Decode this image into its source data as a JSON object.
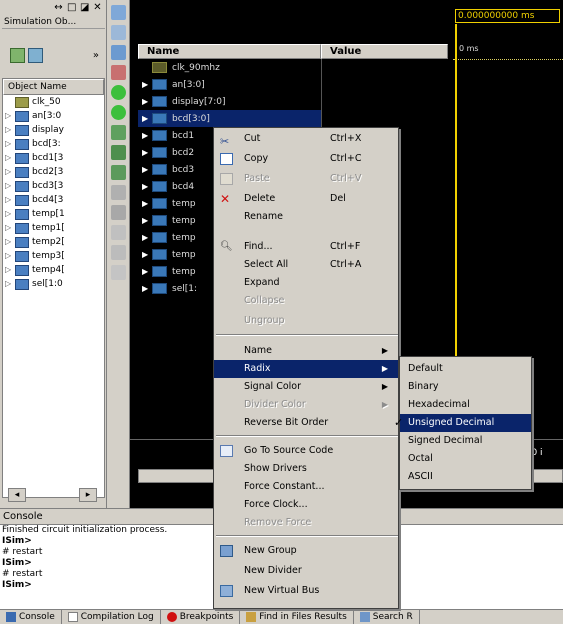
{
  "left_panel": {
    "title_icons": [
      "pin-icon",
      "restore-icon",
      "maximize-icon",
      "close-icon"
    ],
    "title": "Simulation Ob...",
    "toolbar_more": "»",
    "column_header": "Object Name",
    "objects": [
      "clk_50",
      "an[3:0",
      "display",
      "bcd[3:",
      "bcd1[3",
      "bcd2[3",
      "bcd3[3",
      "bcd4[3",
      "temp[1",
      "temp1[",
      "temp2[",
      "temp3[",
      "temp4[",
      "sel[1:0"
    ]
  },
  "wave": {
    "name_header": "Name",
    "value_header": "Value",
    "time_value": "0.000000000 ms",
    "ruler_label": "0 ms",
    "right_time": "000 i",
    "signals": [
      "clk_90mhz",
      "an[3:0]",
      "display[7:0]",
      "bcd[3:0]",
      "bcd1",
      "bcd2",
      "bcd3",
      "bcd4",
      "temp",
      "temp",
      "temp",
      "temp",
      "temp",
      "sel[1:"
    ]
  },
  "context_menu": {
    "cut": {
      "label": "Cut",
      "shortcut": "Ctrl+X"
    },
    "copy": {
      "label": "Copy",
      "shortcut": "Ctrl+C"
    },
    "paste": {
      "label": "Paste",
      "shortcut": "Ctrl+V"
    },
    "delete": {
      "label": "Delete",
      "shortcut": "Del"
    },
    "rename": {
      "label": "Rename"
    },
    "find": {
      "label": "Find...",
      "shortcut": "Ctrl+F"
    },
    "select_all": {
      "label": "Select All",
      "shortcut": "Ctrl+A"
    },
    "expand": {
      "label": "Expand"
    },
    "collapse": {
      "label": "Collapse"
    },
    "ungroup": {
      "label": "Ungroup"
    },
    "name": {
      "label": "Name"
    },
    "radix": {
      "label": "Radix"
    },
    "signal_color": {
      "label": "Signal Color"
    },
    "divider_color": {
      "label": "Divider Color"
    },
    "reverse_bit_order": {
      "label": "Reverse Bit Order"
    },
    "go_to_source": {
      "label": "Go To Source Code"
    },
    "show_drivers": {
      "label": "Show Drivers"
    },
    "force_constant": {
      "label": "Force Constant..."
    },
    "force_clock": {
      "label": "Force Clock..."
    },
    "remove_force": {
      "label": "Remove Force"
    },
    "new_group": {
      "label": "New Group"
    },
    "new_divider": {
      "label": "New Divider"
    },
    "new_virtual_bus": {
      "label": "New Virtual Bus"
    }
  },
  "radix_menu": {
    "items": [
      "Default",
      "Binary",
      "Hexadecimal",
      "Unsigned Decimal",
      "Signed Decimal",
      "Octal",
      "ASCII"
    ],
    "selected": "Unsigned Decimal",
    "check": "✓"
  },
  "console": {
    "header": "Console",
    "lines": [
      "Finished circuit initialization process.",
      "ISim>",
      "# restart",
      "ISim>",
      "# restart",
      "ISim>"
    ]
  },
  "tabs": [
    "Console",
    "Compilation Log",
    "Breakpoints",
    "Find in Files Results",
    "Search R"
  ],
  "colors": {
    "accent": "#0a246a",
    "cursor": "#f0d000",
    "bg": "#d4d0c8"
  }
}
